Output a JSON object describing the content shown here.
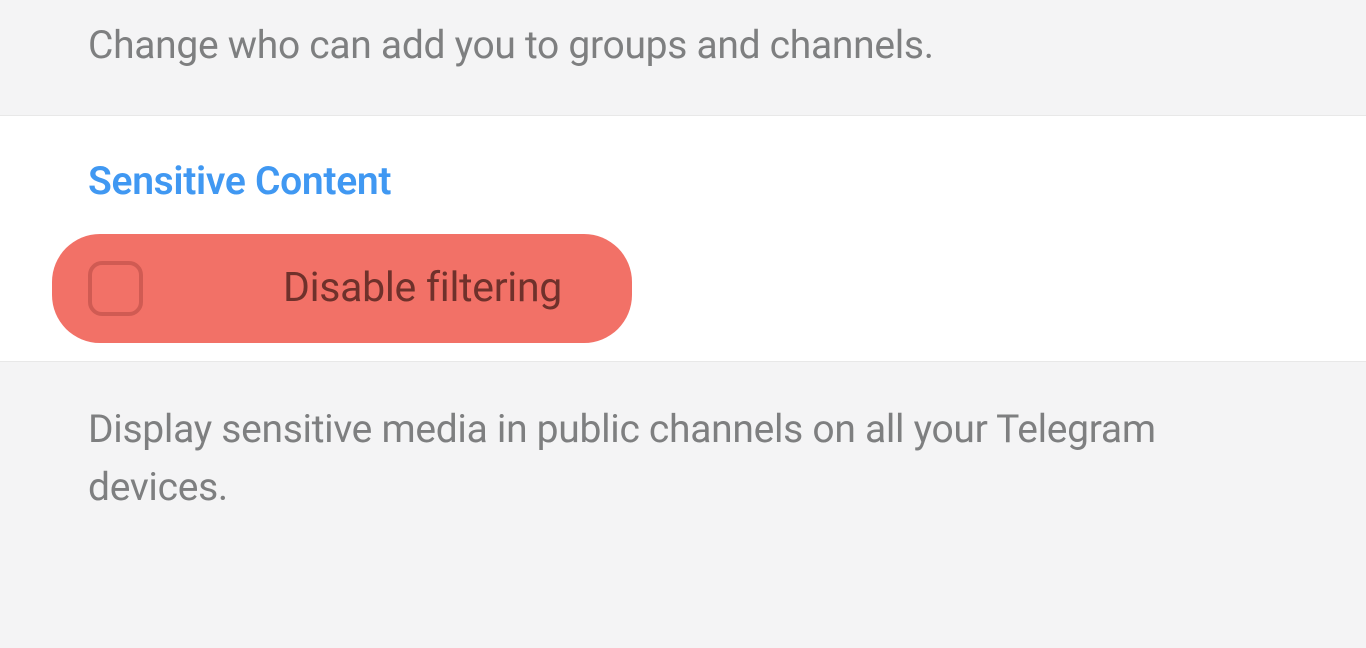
{
  "groups_description": "Change who can add you to groups and channels.",
  "sensitive_content": {
    "header": "Sensitive Content",
    "disable_filtering_label": "Disable filtering",
    "description": "Display sensitive media in public channels on all your Telegram devices."
  }
}
